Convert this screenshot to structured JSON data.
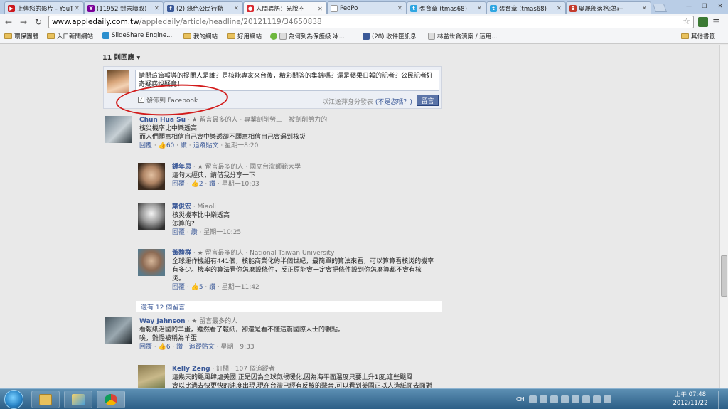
{
  "browser": {
    "tabs": [
      {
        "label": "上傳您的影片 - YouTube",
        "favicon": "youtube",
        "color": "#cc181e"
      },
      {
        "label": "(11952 封未讀取)",
        "favicon": "yahoo-mail",
        "color": "#7b0099"
      },
      {
        "label": "(2) 綠色公民行動",
        "favicon": "facebook",
        "color": "#3b5998"
      },
      {
        "label": "人間異語：光說不",
        "favicon": "apple-daily",
        "color": "#d8282e"
      },
      {
        "label": "PeoPo",
        "favicon": "page",
        "color": "#ffffff"
      },
      {
        "label": "張育章 (tmas68)",
        "favicon": "twitter",
        "color": "#2fa6e1"
      },
      {
        "label": "張育章 (tmas68)",
        "favicon": "twitter",
        "color": "#2fa6e1"
      },
      {
        "label": "吳晟部落格:為莊",
        "favicon": "blogger",
        "color": "#c33b2d"
      }
    ],
    "url_host": "www.appledaily.com.tw",
    "url_path": "/appledaily/article/headline/20121119/34650838",
    "bookmarks": [
      {
        "label": "環保團體",
        "icon": "folder"
      },
      {
        "label": "入口新聞網站",
        "icon": "folder"
      },
      {
        "label": "SlideShare Engine...",
        "icon": "slideshare"
      },
      {
        "label": "我的網站",
        "icon": "folder"
      },
      {
        "label": "好用網站",
        "icon": "folder"
      },
      {
        "label": "為何列為保護級 冰...",
        "icon": "page"
      },
      {
        "label": "(28) 收件匣訊息",
        "icon": "facebook"
      },
      {
        "label": "林益世貪瀆案 / 這用...",
        "icon": "page"
      }
    ],
    "other_bookmarks": "其他書籤"
  },
  "comments_section": {
    "count_label": "11 則回應",
    "composer": {
      "text": "請問這篇報導的提問人是誰？是核能專家來台後，精彩問答的集錦嗎？還是蘋果日報的記者？公民記者好奇疑惑說疑竟！",
      "post_to_facebook": "發佈到 Facebook",
      "posting_as_prefix": "以江逸萍身分發表",
      "not_you": "(不是您嗎？)",
      "submit": "留言"
    },
    "comments": [
      {
        "name": "Chun Hua Su",
        "meta": "· ★ 留言最多的人 · 專業劍削勞工－被劍削勞力的",
        "body": [
          "核災機率比中樂透高",
          "而人們願意相信自己會中樂透卻不願意相信自己會遇到核災"
        ],
        "reply": "回覆",
        "likes": "60",
        "like": "讚",
        "follow": "追蹤貼文",
        "time": "星期一8:20"
      },
      {
        "name": "鍾年思",
        "meta": "· ★ 留言最多的人 · 國立台灣師範大學",
        "body": [
          "這句太經典，請借我分享一下"
        ],
        "reply": "回覆",
        "likes": "2",
        "like": "讚",
        "follow": "",
        "time": "星期一10:03"
      },
      {
        "name": "葉俊宏",
        "meta": "· Miaoli",
        "body": [
          "核災機率比中樂透高",
          "怎算的?"
        ],
        "reply": "回覆",
        "likes": "",
        "like": "讚",
        "follow": "",
        "time": "星期一10:25"
      },
      {
        "name": "黃馥群",
        "meta": "· ★ 留言最多的人 · National Taiwan University",
        "body": [
          "全球運作機組有441個，核能商業化約半個世紀，最簡單的算法來看，可以算算看核災的機率",
          "有多少。機率的算法看你怎麼設條件，反正原能會一定會把條件設到你怎麼算都不會有核",
          "災。"
        ],
        "reply": "回覆",
        "likes": "5",
        "like": "讚",
        "follow": "",
        "time": "星期一11:42"
      }
    ],
    "more_replies": "還有 12 個留言",
    "comments2": [
      {
        "name": "Way Jahnson",
        "meta": "· ★ 留言最多的人",
        "body": [
          "看報紙治國的羊蛋，雖然看了報紙，卻還是看不懂這篇國際人士的觀點。",
          "唉，難怪被稱為羊蛋"
        ],
        "reply": "回覆",
        "likes": "6",
        "like": "讚",
        "follow": "追蹤貼文",
        "time": "星期一9:33"
      },
      {
        "name": "Kelly Zeng",
        "meta": "· 訂閱 · 107 個追蹤者",
        "body": [
          "這幾天的颶風肆虐美國,正是因為全球氣候暖化,因為海平面溫度只要上升1度,這些颶風",
          "會以比過去快更快的速度出現,現在台灣已經有反核的聲音,可以看到美國正以人造紙面去面對"
        ],
        "reply": "",
        "likes": "",
        "like": "",
        "follow": "",
        "time": ""
      }
    ]
  },
  "taskbar": {
    "lang": "CH",
    "time": "上午 07:48",
    "date": "2012/11/22"
  }
}
